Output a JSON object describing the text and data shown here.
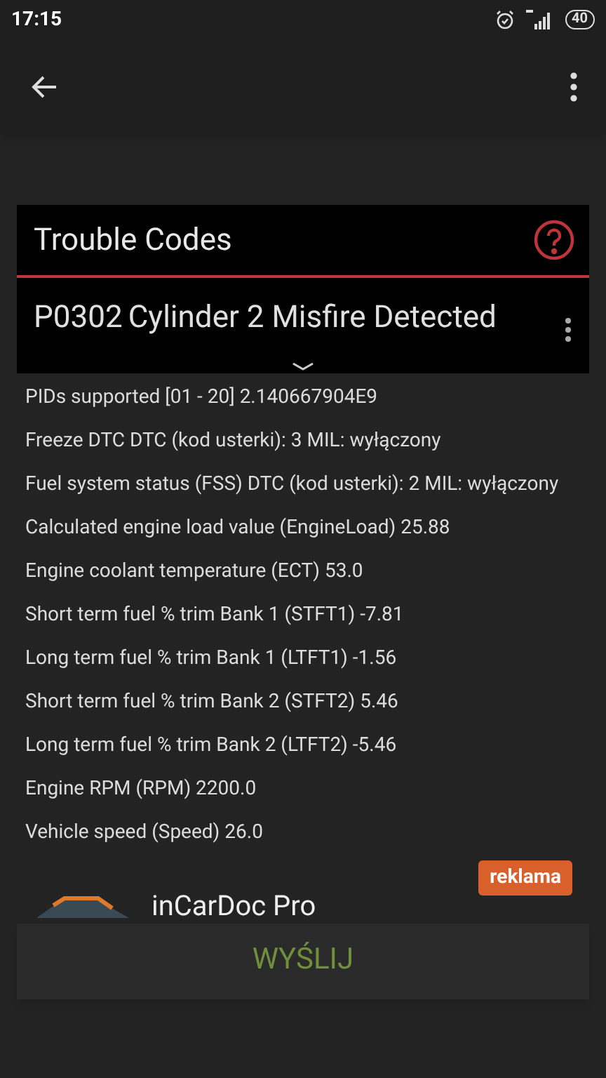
{
  "status_bar": {
    "time": "17:15",
    "battery": "40"
  },
  "card": {
    "title": "Trouble Codes",
    "code": "P0302",
    "description": "Cylinder 2 Misfire Detected"
  },
  "readings": [
    "PIDs supported [01 - 20] 2.140667904E9",
    "Freeze DTC DTC (kod usterki): 3 MIL: wyłączony",
    "Fuel system status (FSS) DTC (kod usterki): 2 MIL: wyłączony",
    "Calculated engine load value (EngineLoad) 25.88",
    "Engine coolant temperature (ECT) 53.0",
    "Short term fuel % trim Bank 1 (STFT1) -7.81",
    "Long term fuel % trim Bank 1 (LTFT1) -1.56",
    "Short term fuel % trim Bank 2 (STFT2) 5.46",
    "Long term fuel % trim Bank 2 (LTFT2) -5.46",
    "Engine RPM (RPM) 2200.0",
    "Vehicle speed (Speed) 26.0"
  ],
  "ad": {
    "badge": "reklama",
    "title": "inCarDoc Pro"
  },
  "send_button": "WYŚLIJ"
}
